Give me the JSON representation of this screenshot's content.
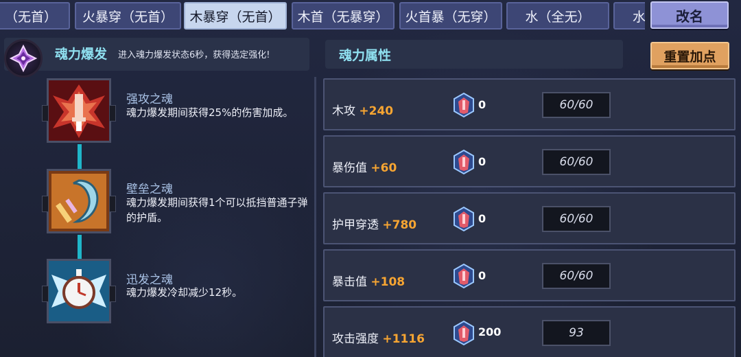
{
  "tabs": [
    {
      "label": "（无首）"
    },
    {
      "label": "火暴穿（无首）"
    },
    {
      "label": "木暴穿（无首）"
    },
    {
      "label": "木首（无暴穿）"
    },
    {
      "label": "火首暴（无穿）"
    },
    {
      "label": "水（全无）"
    },
    {
      "label": "水"
    }
  ],
  "active_tab_index": 2,
  "rename_button": "改名",
  "burst": {
    "title": "魂力爆发",
    "description": "进入魂力爆发状态6秒，获得选定强化!"
  },
  "skills": [
    {
      "name": "强攻之魂",
      "description": "魂力爆发期间获得25%的伤害加成。",
      "icon": "strike-soul-icon"
    },
    {
      "name": "壁垒之魂",
      "description": "魂力爆发期间获得1个可以抵挡普通子弹的护盾。",
      "icon": "shield-soul-icon"
    },
    {
      "name": "迅发之魂",
      "description": "魂力爆发冷却减少12秒。",
      "icon": "swift-soul-icon"
    }
  ],
  "attributes_panel": {
    "title": "魂力属性",
    "reset_button": "重置加点"
  },
  "attributes": [
    {
      "name": "木攻",
      "bonus": "+240",
      "crystals": "0",
      "value": "60/60"
    },
    {
      "name": "暴伤值",
      "bonus": "+60",
      "crystals": "0",
      "value": "60/60"
    },
    {
      "name": "护甲穿透",
      "bonus": "+780",
      "crystals": "0",
      "value": "60/60"
    },
    {
      "name": "暴击值",
      "bonus": "+108",
      "crystals": "0",
      "value": "60/60"
    },
    {
      "name": "攻击强度",
      "bonus": "+1116",
      "crystals": "200",
      "value": "93"
    }
  ],
  "colors": {
    "accent_cyan": "#8fe0f0",
    "bonus_orange": "#f7a532",
    "active_tab": "#c7d6ee",
    "tab": "#3d4675"
  }
}
